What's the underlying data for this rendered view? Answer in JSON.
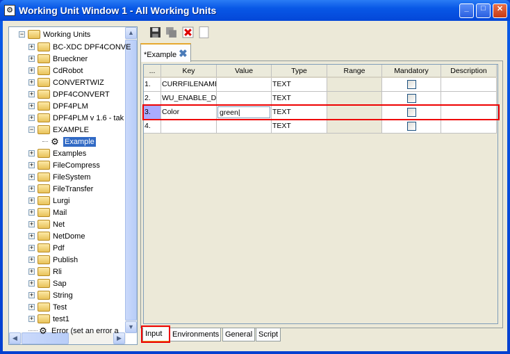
{
  "window": {
    "title": "Working Unit Window 1 - All Working Units",
    "minimize": "_",
    "maximize": "□",
    "close": "✕"
  },
  "tree": {
    "root": "Working Units",
    "items": [
      {
        "label": "BC-XDC DPF4CONVE",
        "type": "folder",
        "expanded": false
      },
      {
        "label": "Brueckner",
        "type": "folder",
        "expanded": false
      },
      {
        "label": "CdRobot",
        "type": "folder",
        "expanded": false
      },
      {
        "label": "CONVERTWIZ",
        "type": "folder",
        "expanded": false
      },
      {
        "label": "DPF4CONVERT",
        "type": "folder",
        "expanded": false
      },
      {
        "label": "DPF4PLM",
        "type": "folder",
        "expanded": false
      },
      {
        "label": "DPF4PLM v 1.6 - tak",
        "type": "folder",
        "expanded": false
      },
      {
        "label": "EXAMPLE",
        "type": "folder",
        "expanded": true
      },
      {
        "label": "Example",
        "type": "unit",
        "child": true,
        "selected": true
      },
      {
        "label": "Examples",
        "type": "folder",
        "expanded": false
      },
      {
        "label": "FileCompress",
        "type": "folder",
        "expanded": false
      },
      {
        "label": "FileSystem",
        "type": "folder",
        "expanded": false
      },
      {
        "label": "FileTransfer",
        "type": "folder",
        "expanded": false
      },
      {
        "label": "Lurgi",
        "type": "folder",
        "expanded": false
      },
      {
        "label": "Mail",
        "type": "folder",
        "expanded": false
      },
      {
        "label": "Net",
        "type": "folder",
        "expanded": false
      },
      {
        "label": "NetDome",
        "type": "folder",
        "expanded": false
      },
      {
        "label": "Pdf",
        "type": "folder",
        "expanded": false
      },
      {
        "label": "Publish",
        "type": "folder",
        "expanded": false
      },
      {
        "label": "Rli",
        "type": "folder",
        "expanded": false
      },
      {
        "label": "Sap",
        "type": "folder",
        "expanded": false
      },
      {
        "label": "String",
        "type": "folder",
        "expanded": false
      },
      {
        "label": "Test",
        "type": "folder",
        "expanded": false
      },
      {
        "label": "test1",
        "type": "folder",
        "expanded": false
      },
      {
        "label": "Error (set an error a",
        "type": "unit",
        "child": false
      }
    ]
  },
  "toolbar": {
    "icons": [
      "save-icon",
      "save-all-icon",
      "delete-icon",
      "blank-icon"
    ]
  },
  "editor_tab": {
    "label": "*Example",
    "close_icon": "close-x-icon"
  },
  "table": {
    "columns": [
      "...",
      "Key",
      "Value",
      "Type",
      "Range",
      "Mandatory",
      "Description"
    ],
    "rows": [
      {
        "num": "1.",
        "key": "CURRFILENAME",
        "value": "",
        "type": "TEXT",
        "range": "",
        "mandatory": false,
        "description": ""
      },
      {
        "num": "2.",
        "key": "WU_ENABLE_DEIN",
        "value": "",
        "type": "TEXT",
        "range": "",
        "mandatory": false,
        "description": ""
      },
      {
        "num": "3.",
        "key": "Color",
        "value": "green",
        "type": "TEXT",
        "range": "",
        "mandatory": false,
        "description": "",
        "selected": true,
        "editing": "value"
      },
      {
        "num": "4.",
        "key": "",
        "value": "",
        "type": "TEXT",
        "range": "",
        "mandatory": false,
        "description": ""
      }
    ]
  },
  "bottom_tabs": [
    {
      "label": "Input",
      "active": true
    },
    {
      "label": "Environments"
    },
    {
      "label": "General"
    },
    {
      "label": "Script"
    }
  ],
  "highlight_color": "#ee0000"
}
